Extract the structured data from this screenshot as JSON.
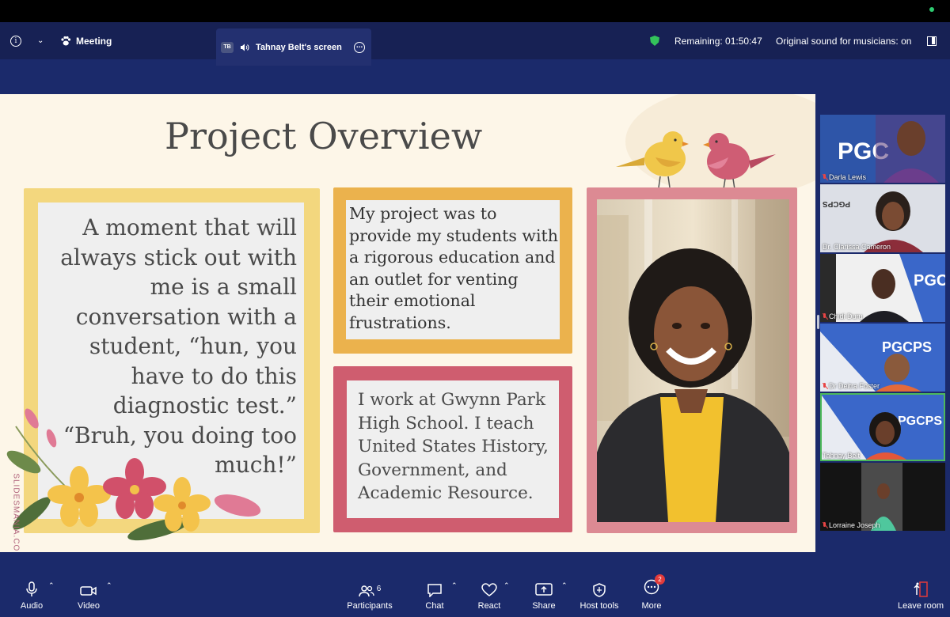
{
  "topbar": {
    "meeting_label": "Meeting",
    "screen_tab_initials": "TB",
    "screen_tab_label": "Tahnay Belt's screen",
    "remaining": "Remaining: 01:50:47",
    "original_sound": "Original sound for musicians: on"
  },
  "slide": {
    "title": "Project Overview",
    "quote": "A moment that will always stick out with me is a small conversation with a student, “hun, you have to do this diagnostic test.” “Bruh, you doing too much!”",
    "project_text": "My project was to provide my students with a rigorous education and an outlet for venting their emotional frustrations.",
    "work_text": "I work at Gwynn Park High School. I teach United States History, Government, and Academic Resource.",
    "watermark": "SLIDESMANIA.COM"
  },
  "participants": [
    {
      "name": "Darla Lewis",
      "muted": true,
      "bg_label": "PGC"
    },
    {
      "name": "Dr. Clarissa Cameron",
      "muted": false,
      "bg_label": "PGCPS"
    },
    {
      "name": "Chidi Duru",
      "muted": true,
      "bg_label": "PGCI"
    },
    {
      "name": "Dr Deitra Foster",
      "muted": true,
      "bg_label": "PGCPS"
    },
    {
      "name": "Tahnay Belt",
      "muted": false,
      "bg_label": "PGCPS"
    },
    {
      "name": "Lorraine Joseph",
      "muted": true,
      "bg_label": ""
    }
  ],
  "bottombar": {
    "audio": "Audio",
    "video": "Video",
    "participants": "Participants",
    "participants_count": "6",
    "chat": "Chat",
    "react": "React",
    "share": "Share",
    "host_tools": "Host tools",
    "more": "More",
    "more_badge": "2",
    "leave": "Leave room"
  },
  "colors": {
    "background": "#1b2a6b",
    "topbar": "#172154",
    "yellow_frame": "#f3d77e",
    "gold_frame": "#ebb24d",
    "rose_frame": "#cf5d6f",
    "pink_frame": "#dc8a93",
    "active_speaker": "#4cb85a"
  }
}
